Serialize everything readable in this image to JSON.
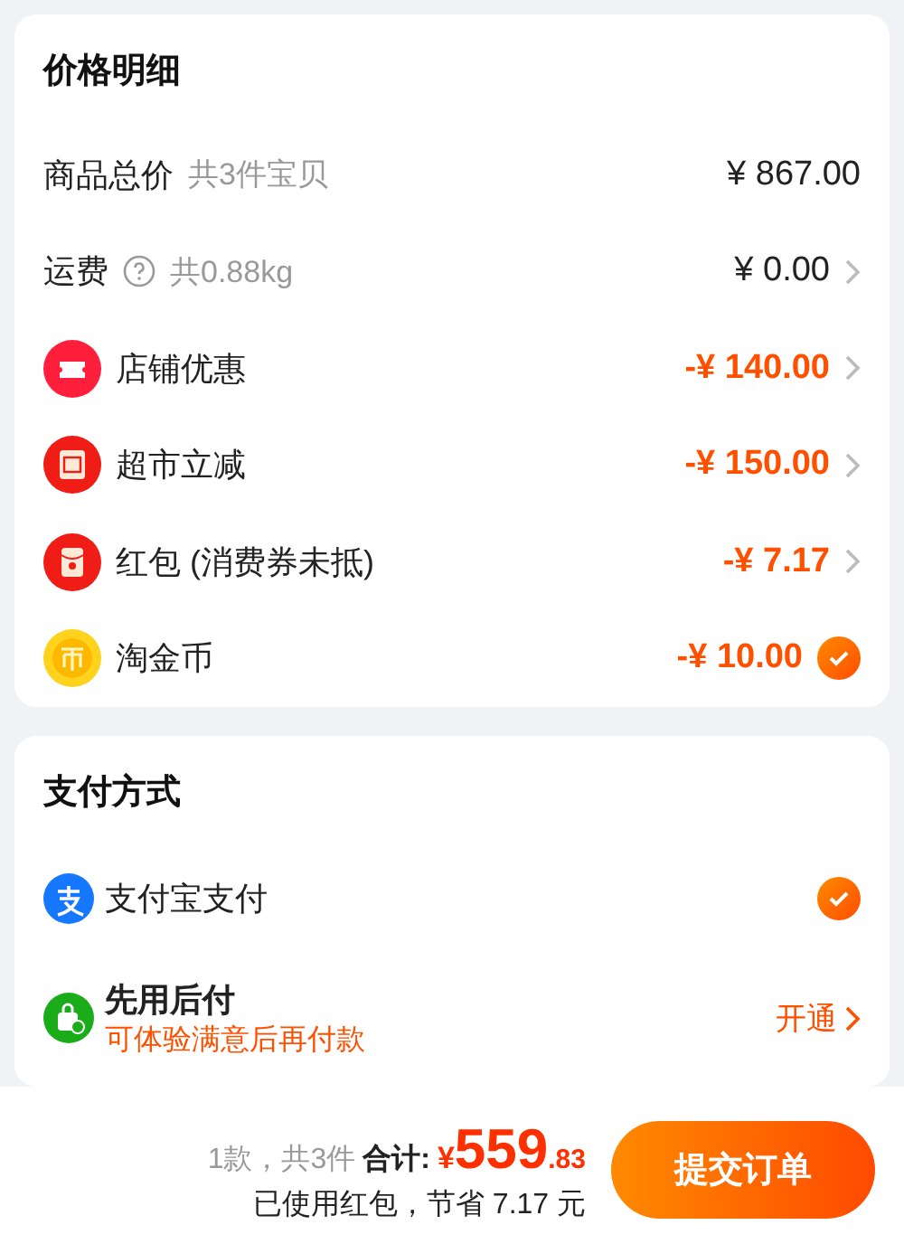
{
  "price_details": {
    "title": "价格明细",
    "rows": [
      {
        "kind": "total",
        "label": "商品总价",
        "note": "共3件宝贝",
        "amount": "¥ 867.00"
      },
      {
        "kind": "shipping",
        "label": "运费",
        "note": "共0.88kg",
        "amount": "¥ 0.00"
      },
      {
        "kind": "coupon",
        "label": "店铺优惠",
        "amount": "-¥ 140.00"
      },
      {
        "kind": "reduction",
        "label": "超市立减",
        "amount": "-¥ 150.00"
      },
      {
        "kind": "redpacket",
        "label": "红包 (消费券未抵)",
        "amount": "-¥ 7.17"
      },
      {
        "kind": "coin",
        "label": "淘金币",
        "amount": "-¥ 10.00",
        "checked": true
      }
    ]
  },
  "payment": {
    "title": "支付方式",
    "methods": [
      {
        "kind": "alipay",
        "label": "支付宝支付",
        "selected": true
      },
      {
        "kind": "paylater",
        "label": "先用后付",
        "subtitle": "可体验满意后再付款",
        "action": "开通"
      }
    ]
  },
  "footer": {
    "count": "1款，共3件",
    "total_label": "合计:",
    "currency": "¥",
    "integer": "559",
    "decimals": ".83",
    "savings": "已使用红包，节省 7.17 元",
    "submit": "提交订单"
  }
}
